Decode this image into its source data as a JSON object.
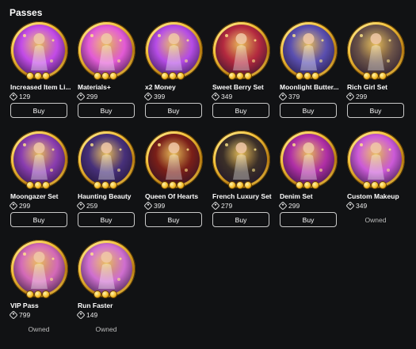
{
  "header": {
    "title": "Passes"
  },
  "passes": [
    {
      "name": "Increased Item Li...",
      "price": "129",
      "action": "Buy",
      "art": "item-limit-icon",
      "bg": "#c34be8"
    },
    {
      "name": "Materials+",
      "price": "299",
      "action": "Buy",
      "art": "mannequin-icon",
      "bg": "#e35bd6"
    },
    {
      "name": "x2 Money",
      "price": "399",
      "action": "Buy",
      "art": "money-bag-icon",
      "bg": "#b54ce6"
    },
    {
      "name": "Sweet Berry Set",
      "price": "349",
      "action": "Buy",
      "art": "berry-outfit-icon",
      "bg": "#b3293f"
    },
    {
      "name": "Moonlight Butter...",
      "price": "379",
      "action": "Buy",
      "art": "butterfly-outfit-icon",
      "bg": "#5a4fb0"
    },
    {
      "name": "Rich Girl Set",
      "price": "299",
      "action": "Buy",
      "art": "rich-girl-outfit-icon",
      "bg": "#6a5248"
    },
    {
      "name": "Moongazer Set",
      "price": "299",
      "action": "Buy",
      "art": "moongazer-outfit-icon",
      "bg": "#8a3db0"
    },
    {
      "name": "Haunting Beauty",
      "price": "259",
      "action": "Buy",
      "art": "haunting-outfit-icon",
      "bg": "#47307a"
    },
    {
      "name": "Queen Of Hearts",
      "price": "399",
      "action": "Buy",
      "art": "hearts-outfit-icon",
      "bg": "#7a1f18"
    },
    {
      "name": "French Luxury Set",
      "price": "279",
      "action": "Buy",
      "art": "luxury-outfit-icon",
      "bg": "#3b2f28"
    },
    {
      "name": "Denim Set",
      "price": "299",
      "action": "Buy",
      "art": "denim-outfit-icon",
      "bg": "#b02fa6"
    },
    {
      "name": "Custom Makeup",
      "price": "349",
      "action": "Owned",
      "art": "makeup-icon",
      "bg": "#cc5ad8"
    },
    {
      "name": "VIP Pass",
      "price": "799",
      "action": "Owned",
      "art": "vip-icon",
      "bg": "#d46ab8"
    },
    {
      "name": "Run Faster",
      "price": "149",
      "action": "Owned",
      "art": "heels-icon",
      "bg": "#d06fd0"
    }
  ],
  "colors": {
    "background": "#111214",
    "badge_gold": "#f2c03a",
    "button_border": "#c9c9c9"
  }
}
